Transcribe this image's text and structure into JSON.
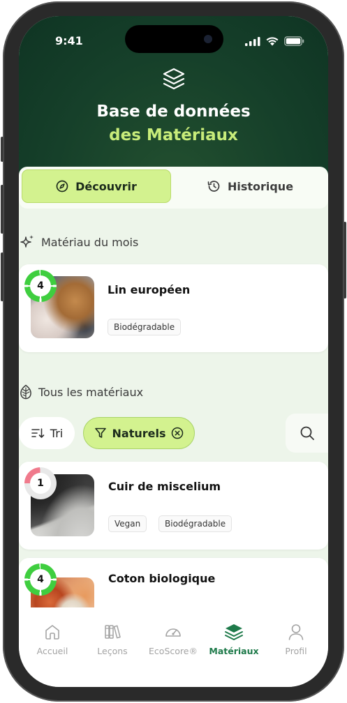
{
  "status_bar": {
    "time": "9:41"
  },
  "header": {
    "title_line1": "Base de données",
    "title_line2": "des Matériaux"
  },
  "tabs": [
    {
      "label": "Découvrir",
      "icon": "compass-icon",
      "active": true
    },
    {
      "label": "Historique",
      "icon": "history-icon",
      "active": false
    }
  ],
  "featured": {
    "section_label": "Matériau du mois",
    "icon": "sparkles-icon",
    "item": {
      "score": "4",
      "name": "Lin européen",
      "tags": [
        "Biodégradable"
      ]
    }
  },
  "all_materials": {
    "section_label": "Tous les matériaux",
    "icon": "leaf-icon",
    "sort_label": "Tri",
    "filter_label": "Naturels",
    "items": [
      {
        "score": "1",
        "name": "Cuir de miscelium",
        "tags": [
          "Vegan",
          "Biodégradable"
        ]
      },
      {
        "score": "4",
        "name": "Coton biologique",
        "tags": []
      }
    ]
  },
  "colors": {
    "header_bg": "#16402a",
    "accent_lime": "#d3f28f",
    "accent_green": "#1e7a4a",
    "score_good": "#3fce3f",
    "score_bad": "#f07a8c"
  },
  "nav": [
    {
      "label": "Accueil",
      "icon": "home-icon",
      "active": false
    },
    {
      "label": "Leçons",
      "icon": "books-icon",
      "active": false
    },
    {
      "label": "EcoScore®",
      "icon": "gauge-icon",
      "active": false
    },
    {
      "label": "Matériaux",
      "icon": "layers-icon",
      "active": true
    },
    {
      "label": "Profil",
      "icon": "user-icon",
      "active": false
    }
  ]
}
